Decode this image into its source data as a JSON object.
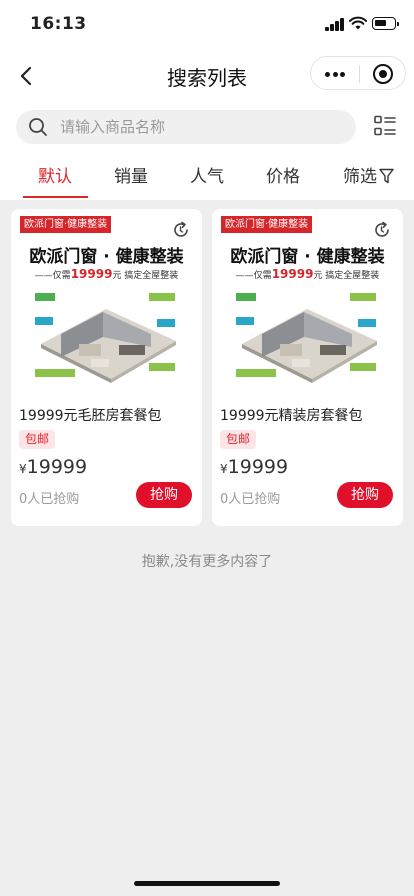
{
  "status_bar": {
    "time": "16:13"
  },
  "nav": {
    "title": "搜索列表"
  },
  "search": {
    "placeholder": "请输入商品名称"
  },
  "tabs": [
    {
      "label": "默认",
      "active": true
    },
    {
      "label": "销量"
    },
    {
      "label": "人气"
    },
    {
      "label": "价格"
    },
    {
      "label": "筛选"
    }
  ],
  "colors": {
    "accent": "#e0262c",
    "button": "#e0102a",
    "tag_bg": "#fde4e6"
  },
  "products": [
    {
      "promo_tag": "欧派门窗·健康整装",
      "banner_title": "欧派门窗 · 健康整装",
      "banner_sub_prefix": "——仅需",
      "banner_sub_price": "19999",
      "banner_sub_suffix": "元  搞定全屋整装",
      "name": "19999元毛胚房套餐包",
      "tag": "包邮",
      "currency": "¥",
      "price": "19999",
      "sold": "0人已抢购",
      "button": "抢购"
    },
    {
      "promo_tag": "欧派门窗·健康整装",
      "banner_title": "欧派门窗 · 健康整装",
      "banner_sub_prefix": "——仅需",
      "banner_sub_price": "19999",
      "banner_sub_suffix": "元  搞定全屋整装",
      "name": "19999元精装房套餐包",
      "tag": "包邮",
      "currency": "¥",
      "price": "19999",
      "sold": "0人已抢购",
      "button": "抢购"
    }
  ],
  "footer": {
    "message": "抱歉,没有更多内容了"
  }
}
